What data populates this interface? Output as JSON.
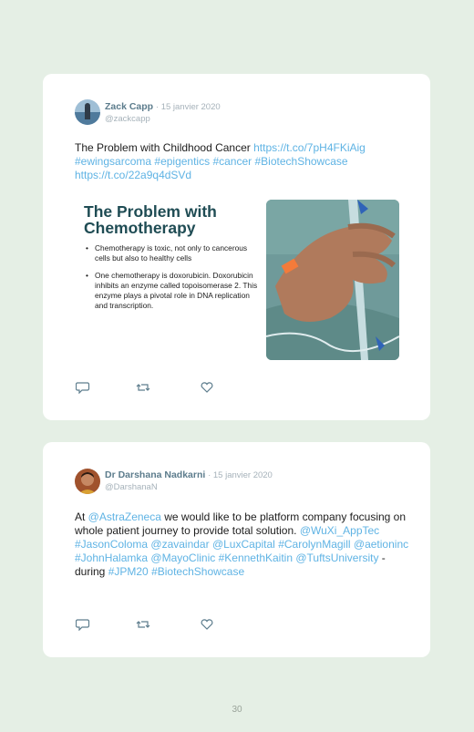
{
  "tweets": [
    {
      "author": "Zack Capp",
      "date": "· 15 janvier 2020",
      "handle": "@zackcapp",
      "text": {
        "t0": "The Problem with Childhood Cancer ",
        "l0": "https://t.co/7pH4FKiAig",
        "l1": "#ewingsarcoma",
        "l2": "#epigentics",
        "l3": "#cancer",
        "l4": "#BiotechShowcase",
        "l5": "https://t.co/22a9q4dSVd"
      },
      "media": {
        "slide_title": "The Problem with Chemotherapy",
        "bullet_1": "Chemotherapy is toxic, not only to cancerous cells but also to healthy cells",
        "bullet_2": "One chemotherapy is doxorubicin. Doxorubicin inhibits an enzyme called topoisomerase 2. This enzyme plays a pivotal role in DNA replication and transcription."
      }
    },
    {
      "author": "Dr Darshana Nadkarni",
      "date": "· 15 janvier 2020",
      "handle": "@DarshanaN",
      "text": {
        "t0": "At ",
        "l0": "@AstraZeneca",
        "t1": " we would like to be platform company focusing on whole patient journey to provide total solution. ",
        "l1": "@WuXi_AppTec",
        "l2": "#JasonColoma",
        "l3": "@zavaindar",
        "l4": "@LuxCapital",
        "l5": "#CarolynMagill",
        "l6": "@aetioninc",
        "l7": "#JohnHalamka",
        "l8": "@MayoClinic",
        "l9": "#KennethKaitin",
        "l10": "@TuftsUniversity",
        "t2": " - during ",
        "l11": "#JPM20",
        "l12": "#BiotechShowcase"
      }
    }
  ],
  "icons": [
    "reply-icon",
    "retweet-icon",
    "like-icon"
  ],
  "colors": {
    "link": "#5fb3e4",
    "author": "#5c7c8c",
    "background": "#e5efe5"
  },
  "page_number": "30"
}
